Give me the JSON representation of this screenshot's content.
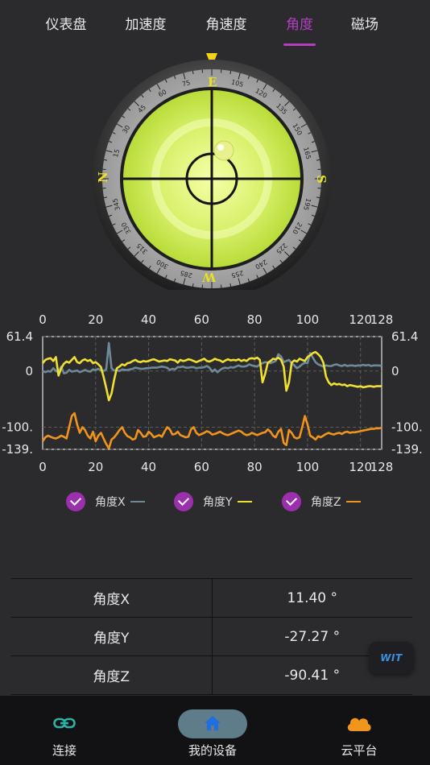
{
  "tabs": [
    {
      "label": "仪表盘",
      "active": false
    },
    {
      "label": "加速度",
      "active": false
    },
    {
      "label": "角速度",
      "active": false
    },
    {
      "label": "角度",
      "active": true
    },
    {
      "label": "磁场",
      "active": false
    }
  ],
  "compass": {
    "cardinals": {
      "top": "E",
      "right": "S",
      "bottom": "W",
      "left": "N"
    },
    "degree_labels": [
      "75",
      "105",
      "120",
      "135",
      "150",
      "165",
      "195",
      "210",
      "225",
      "240",
      "255",
      "285",
      "300",
      "315",
      "330",
      "345",
      "15",
      "30",
      "45",
      "60"
    ]
  },
  "chart_data": {
    "type": "line",
    "x_ticks": [
      "0",
      "20",
      "40",
      "60",
      "80",
      "100",
      "120",
      "128"
    ],
    "y_ticks_left": [
      "61.4",
      "0",
      "-100.",
      "-139."
    ],
    "y_ticks_right": [
      "61.4",
      "0",
      "-100.",
      "-139."
    ],
    "ylim": [
      -139.4,
      61.4
    ],
    "xlim": [
      0,
      128
    ],
    "series": [
      {
        "name": "角度X",
        "color": "#6f8a97",
        "values": [
          0,
          -2,
          0,
          -1,
          5,
          0,
          -2,
          8,
          -4,
          -3,
          2,
          -1,
          0,
          1,
          -2,
          0,
          2,
          0,
          -1,
          3,
          2,
          4,
          1,
          0,
          3,
          50,
          5,
          1,
          2,
          0,
          3,
          2,
          2,
          3,
          4,
          6,
          5,
          4,
          4,
          5,
          5,
          6,
          6,
          6,
          7,
          8,
          7,
          6,
          2,
          4,
          3,
          7,
          7,
          8,
          6,
          6,
          7,
          7,
          5,
          6,
          6,
          7,
          9,
          6,
          -1,
          3,
          -2,
          2,
          5,
          6,
          5,
          7,
          6,
          8,
          10,
          8,
          8,
          9,
          12,
          10,
          9,
          8,
          12,
          14,
          16,
          15,
          14,
          16,
          18,
          30,
          26,
          16,
          18,
          20,
          14,
          10,
          5,
          8,
          12,
          15,
          14,
          32,
          24,
          16,
          12,
          10,
          8,
          10,
          9,
          9,
          11,
          12,
          10,
          9,
          11,
          9,
          10,
          10,
          9,
          10,
          10,
          11,
          10,
          11,
          9,
          10,
          10,
          10,
          9
        ]
      },
      {
        "name": "角度Y",
        "color": "#f0e033",
        "values": [
          14,
          20,
          22,
          23,
          18,
          25,
          -8,
          5,
          13,
          17,
          15,
          20,
          25,
          16,
          14,
          19,
          21,
          18,
          20,
          14,
          16,
          12,
          7,
          -10,
          -30,
          -52,
          -40,
          -15,
          5,
          8,
          12,
          10,
          14,
          15,
          18,
          20,
          17,
          16,
          18,
          17,
          18,
          20,
          21,
          19,
          17,
          18,
          19,
          18,
          21,
          20,
          19,
          15,
          20,
          18,
          19,
          21,
          20,
          18,
          16,
          18,
          20,
          22,
          18,
          17,
          19,
          22,
          20,
          19,
          16,
          19,
          21,
          19,
          20,
          19,
          21,
          18,
          20,
          18,
          22,
          23,
          22,
          24,
          20,
          -20,
          -5,
          15,
          18,
          22,
          21,
          24,
          20,
          8,
          -35,
          -20,
          15,
          19,
          17,
          22,
          20,
          18,
          25,
          28,
          32,
          34,
          30,
          25,
          15,
          -10,
          -20,
          -25,
          -22,
          -24,
          -23,
          -25,
          -24,
          -27,
          -25,
          -26,
          -27,
          -28,
          -27,
          -29,
          -28,
          -27,
          -27,
          -28,
          -27,
          -27,
          -27
        ]
      },
      {
        "name": "角度Z",
        "color": "#f0941c",
        "values": [
          -125,
          -118,
          -115,
          -117,
          -119,
          -120,
          -118,
          -115,
          -117,
          -120,
          -100,
          -80,
          -75,
          -95,
          -110,
          -100,
          -105,
          -115,
          -120,
          -108,
          -125,
          -115,
          -110,
          -120,
          -130,
          -138,
          -122,
          -118,
          -112,
          -105,
          -100,
          -110,
          -116,
          -118,
          -122,
          -120,
          -105,
          -110,
          -117,
          -116,
          -108,
          -112,
          -118,
          -116,
          -114,
          -117,
          -108,
          -100,
          -104,
          -113,
          -112,
          -108,
          -114,
          -116,
          -118,
          -117,
          -104,
          -100,
          -110,
          -114,
          -112,
          -110,
          -107,
          -109,
          -113,
          -112,
          -110,
          -108,
          -111,
          -113,
          -114,
          -112,
          -110,
          -108,
          -106,
          -108,
          -112,
          -114,
          -113,
          -110,
          -112,
          -114,
          -112,
          -110,
          -109,
          -104,
          -108,
          -115,
          -118,
          -108,
          -103,
          -128,
          -132,
          -105,
          -110,
          -118,
          -120,
          -118,
          -100,
          -80,
          -95,
          -115,
          -118,
          -122,
          -116,
          -118,
          -115,
          -112,
          -110,
          -112,
          -113,
          -111,
          -110,
          -112,
          -109,
          -108,
          -110,
          -109,
          -109,
          -108,
          -107,
          -106,
          -105,
          -104,
          -103,
          -103,
          -102,
          -102,
          -101
        ]
      }
    ]
  },
  "legend": [
    {
      "label": "角度X",
      "color": "#6f8a97"
    },
    {
      "label": "角度Y",
      "color": "#f0e033"
    },
    {
      "label": "角度Z",
      "color": "#f0941c"
    }
  ],
  "table": [
    {
      "name": "角度X",
      "value": "11.40 °"
    },
    {
      "name": "角度Y",
      "value": "-27.27 °"
    },
    {
      "name": "角度Z",
      "value": "-90.41 °"
    }
  ],
  "fab": {
    "label": "WIT"
  },
  "nav": {
    "connect": "连接",
    "devices": "我的设备",
    "cloud": "云平台"
  },
  "colors": {
    "accent": "#b13fc0",
    "bubble": "#d8f06a",
    "bg": "#2b2b2d"
  }
}
